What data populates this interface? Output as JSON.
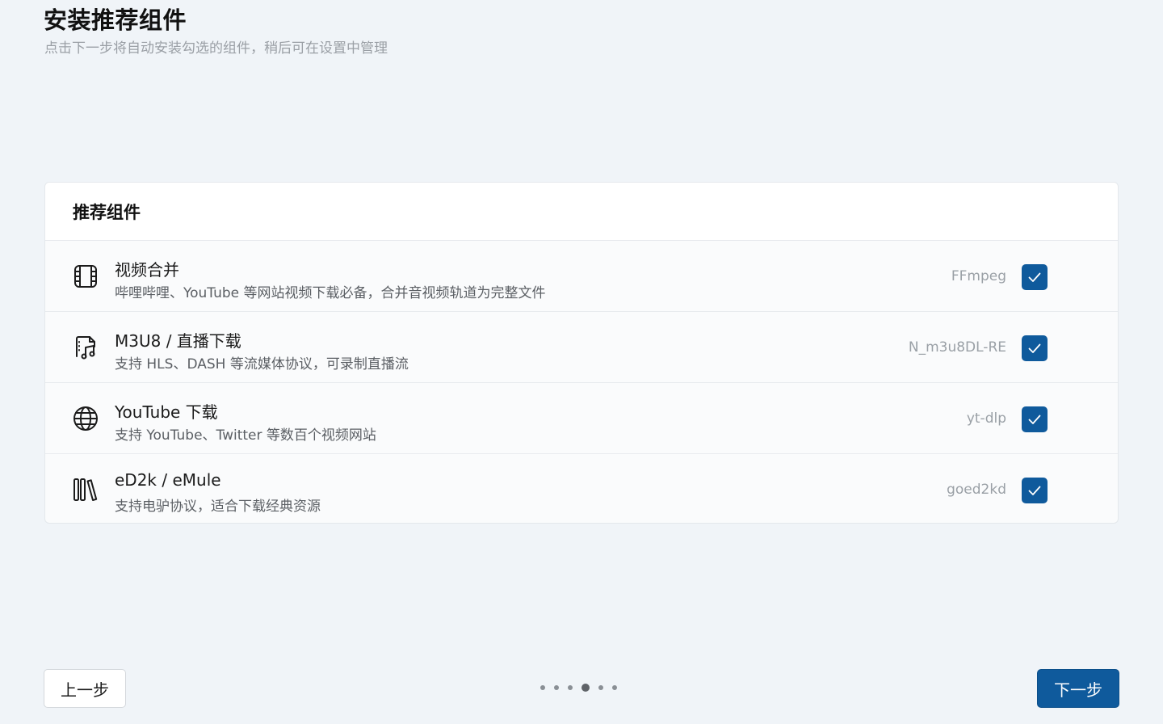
{
  "header": {
    "title": "安装推荐组件",
    "subtitle": "点击下一步将自动安装勾选的组件，稍后可在设置中管理"
  },
  "card": {
    "title": "推荐组件",
    "items": [
      {
        "icon": "film-icon",
        "title": "视频合并",
        "description": "哔哩哔哩、YouTube 等网站视频下载必备，合并音视频轨道为完整文件",
        "tag": "FFmpeg",
        "checked": true
      },
      {
        "icon": "music-file-icon",
        "title": "M3U8 / 直播下载",
        "description": "支持 HLS、DASH 等流媒体协议，可录制直播流",
        "tag": "N_m3u8DL-RE",
        "checked": true
      },
      {
        "icon": "globe-icon",
        "title": "YouTube 下载",
        "description": "支持 YouTube、Twitter 等数百个视频网站",
        "tag": "yt-dlp",
        "checked": true
      },
      {
        "icon": "library-icon",
        "title": "eD2k / eMule",
        "description": "支持电驴协议，适合下载经典资源",
        "tag": "goed2kd",
        "checked": true
      }
    ]
  },
  "footer": {
    "back_label": "上一步",
    "next_label": "下一步",
    "steps_total": 6,
    "current_step": 4
  },
  "colors": {
    "accent": "#0f5a9c",
    "background": "#f0f4f8"
  }
}
